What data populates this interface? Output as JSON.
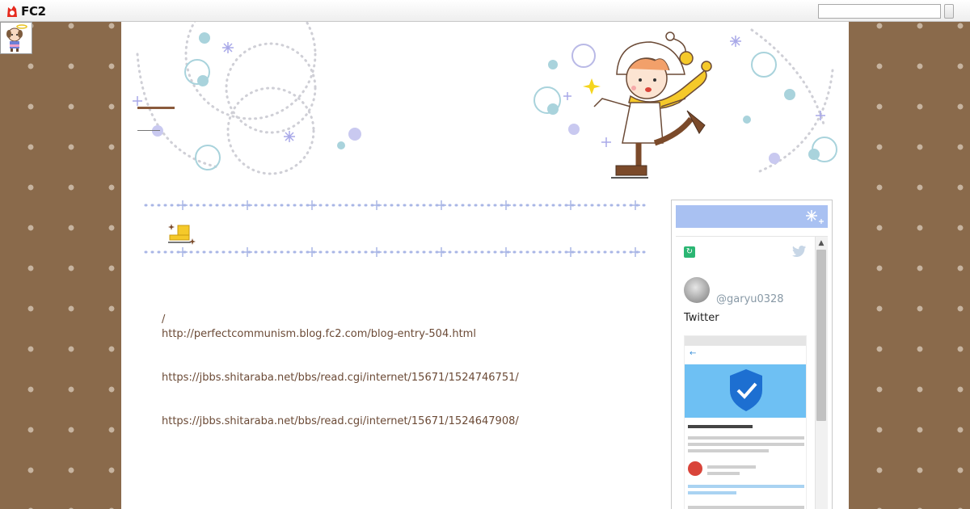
{
  "topbar": {
    "logo_text": "FC2",
    "search_placeholder": ""
  },
  "colors": {
    "background": "#8a6a4b",
    "dots": "#c6b39f",
    "link": "#6b4a36",
    "sidebar_header": "#a9c1f2"
  },
  "icons": {
    "badge": "mascot-icon",
    "entry_title": "skate-icon",
    "twitter": "twitter-bird-icon"
  },
  "entry": {
    "slash": "/",
    "links": [
      "http://perfectcommunism.blog.fc2.com/blog-entry-504.html",
      "https://jbbs.shitaraba.net/bbs/read.cgi/internet/15671/1524746751/",
      "https://jbbs.shitaraba.net/bbs/read.cgi/internet/15671/1524647908/"
    ]
  },
  "sidebar": {
    "twitter": {
      "handle": "@garyu0328",
      "label": "Twitter"
    }
  }
}
